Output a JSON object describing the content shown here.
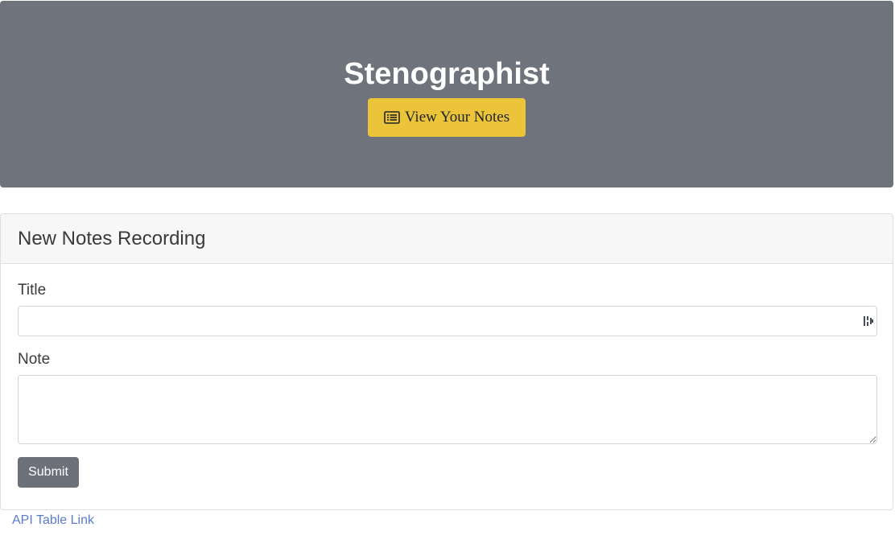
{
  "header": {
    "title": "Stenographist",
    "view_notes_label": "View Your Notes",
    "view_notes_icon": "list-alt-icon",
    "background_color": "#6f737b",
    "button_color": "#ebc43a"
  },
  "form_card": {
    "heading": "New Notes Recording",
    "title_label": "Title",
    "title_value": "",
    "note_label": "Note",
    "note_value": "",
    "submit_label": "Submit",
    "submit_color": "#6c7078"
  },
  "footer": {
    "api_link_label": "API Table Link",
    "link_color": "#5b7bd0"
  }
}
